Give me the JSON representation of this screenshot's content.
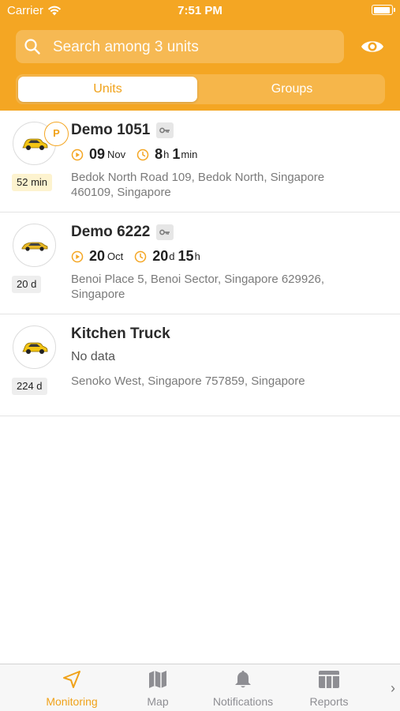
{
  "status_bar": {
    "carrier": "Carrier",
    "time": "7:51 PM"
  },
  "search": {
    "placeholder": "Search among 3 units"
  },
  "segments": {
    "units": "Units",
    "groups": "Groups",
    "active": "Units"
  },
  "units": [
    {
      "name": "Demo 1051",
      "parked_badge": "P",
      "age": "52 min",
      "date_day": "09",
      "date_month": "Nov",
      "duration_a": "8",
      "duration_a_unit": "h",
      "duration_b": "1",
      "duration_b_unit": "min",
      "address": "Bedok North Road 109, Bedok North, Singapore 460109, Singapore"
    },
    {
      "name": "Demo 6222",
      "age": "20 d",
      "date_day": "20",
      "date_month": "Oct",
      "duration_a": "20",
      "duration_a_unit": "d",
      "duration_b": "15",
      "duration_b_unit": "h",
      "address": "Benoi Place 5, Benoi Sector, Singapore 629926, Singapore"
    },
    {
      "name": "Kitchen Truck",
      "age": "224 d",
      "status": "No data",
      "address": "Senoko West, Singapore 757859, Singapore"
    }
  ],
  "tabbar": {
    "monitoring": "Monitoring",
    "map": "Map",
    "notifications": "Notifications",
    "reports": "Reports",
    "active": "Monitoring"
  },
  "colors": {
    "accent": "#f4a623",
    "accent_text": "#f0a21a",
    "fresh_badge": "#fdf3cf"
  }
}
